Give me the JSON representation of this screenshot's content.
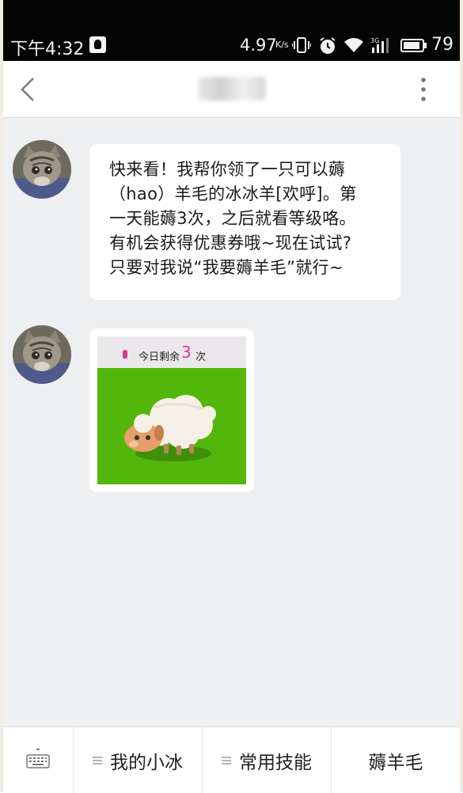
{
  "status_bar": {
    "time": "下午4:32",
    "speed_value": "4.97",
    "speed_unit": "K/s",
    "battery": "79"
  },
  "header": {
    "back_icon": "chevron-left-icon",
    "more_icon": "vertical-dots-icon"
  },
  "messages": [
    {
      "type": "text",
      "lines": [
        "快来看！我帮你领了一只可以薅",
        "（hao）羊毛的冰冰羊[欢呼]。第",
        "一天能薅3次，之后就看等级咯。",
        "有机会获得优惠券哦~现在试试?",
        "只要对我说“我要薅羊毛”就行~"
      ]
    },
    {
      "type": "card",
      "remaining_label": "今日剩余",
      "remaining_count": "3",
      "remaining_unit": "次"
    }
  ],
  "bottom_bar": {
    "keyboard_icon": "keyboard-icon",
    "items": [
      "我的小冰",
      "常用技能",
      "薅羊毛"
    ]
  },
  "colors": {
    "accent_pink": "#e0359a",
    "card_green": "#52b70a",
    "chat_bg": "#edeff1"
  }
}
